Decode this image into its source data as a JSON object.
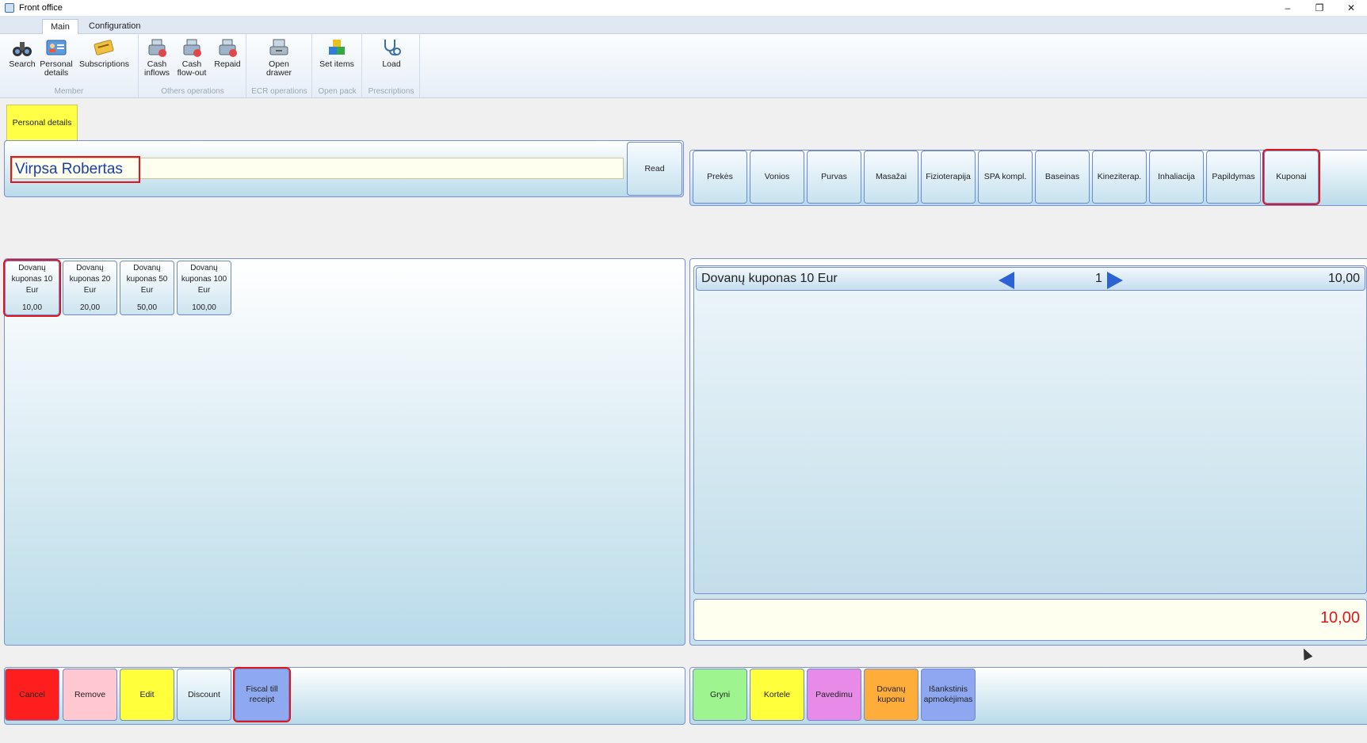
{
  "window": {
    "title": "Front office",
    "controls": [
      "–",
      "❐",
      "✕"
    ]
  },
  "ribbon": {
    "tabs": [
      "Main",
      "Configuration"
    ],
    "groups": {
      "member": "Member",
      "others": "Others operations",
      "ecr": "ECR operations",
      "openpack": "Open pack",
      "prescriptions": "Prescriptions"
    },
    "buttons": {
      "search": "Search",
      "personal_details": "Personal details",
      "subscriptions": "Subscriptions",
      "cash_inflows": "Cash inflows",
      "cash_flowout": "Cash flow-out",
      "repaid": "Repaid",
      "open_drawer": "Open drawer",
      "set_items": "Set items",
      "load": "Load"
    }
  },
  "personal": {
    "tab": "Personal details",
    "name": "Virpsa Robertas",
    "read": "Read"
  },
  "categories": [
    "Prekės",
    "Vonios",
    "Purvas",
    "Masažai",
    "Fizioterapija",
    "SPA kompl.",
    "Baseinas",
    "Kineziterap.",
    "Inhaliacija",
    "Papildymas",
    "Kuponai"
  ],
  "items": [
    {
      "name": "Dovanų kuponas 10 Eur",
      "price": "10,00"
    },
    {
      "name": "Dovanų kuponas 20 Eur",
      "price": "20,00"
    },
    {
      "name": "Dovanų kuponas 50 Eur",
      "price": "50,00"
    },
    {
      "name": "Dovanų kuponas 100 Eur",
      "price": "100,00"
    }
  ],
  "order": {
    "line": {
      "name": "Dovanų kuponas 10 Eur",
      "qty": "1",
      "price": "10,00"
    },
    "total": "10,00"
  },
  "actions": {
    "cancel": "Cancel",
    "remove": "Remove",
    "edit": "Edit",
    "discount": "Discount",
    "fiscal": "Fiscal till receipt"
  },
  "payments": {
    "cash": "Gryni",
    "card": "Kortele",
    "transfer": "Pavedimu",
    "voucher": "Dovanų kuponu",
    "prepaid": "Išankstinis apmokėjimas"
  },
  "colors": {
    "cancel": "#ff1e1e",
    "remove": "#ffc7cf",
    "edit": "#ffff3c",
    "fiscal": "#8fa9f0",
    "cash": "#9ef58f",
    "card": "#ffff3c",
    "transfer": "#e88be8",
    "voucher": "#ffad3a",
    "prepaid": "#8ea7f0",
    "highlight": "#e0161c"
  }
}
